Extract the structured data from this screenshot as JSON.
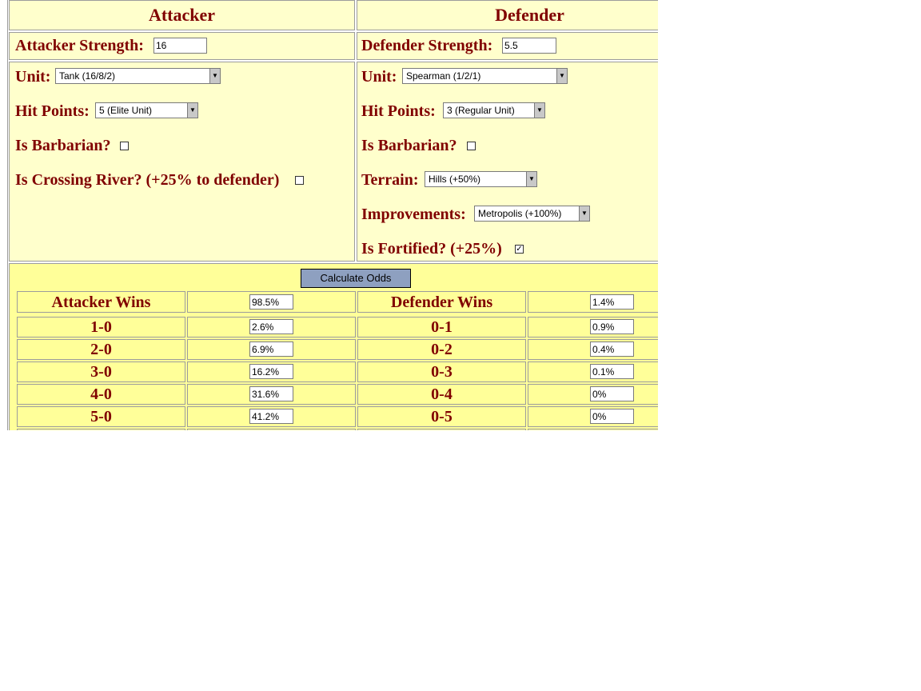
{
  "headers": {
    "attacker": "Attacker",
    "defender": "Defender"
  },
  "attacker": {
    "strength_label": "Attacker Strength:",
    "strength_value": "16",
    "unit_label": "Unit:",
    "unit_value": "Tank (16/8/2)",
    "hp_label": "Hit Points:",
    "hp_value": "5 (Elite Unit)",
    "barbarian_label": "Is Barbarian?",
    "barbarian_checked": false,
    "river_label": "Is Crossing River? (+25% to defender)",
    "river_checked": false
  },
  "defender": {
    "strength_label": "Defender Strength:",
    "strength_value": "5.5",
    "unit_label": "Unit:",
    "unit_value": "Spearman (1/2/1)",
    "hp_label": "Hit Points:",
    "hp_value": "3 (Regular Unit)",
    "barbarian_label": "Is Barbarian?",
    "barbarian_checked": false,
    "terrain_label": "Terrain:",
    "terrain_value": "Hills (+50%)",
    "improvements_label": "Improvements:",
    "improvements_value": "Metropolis (+100%)",
    "fortified_label": "Is Fortified? (+25%)",
    "fortified_checked": true
  },
  "calculate_button": "Calculate Odds",
  "results": {
    "attacker_wins_label": "Attacker Wins",
    "attacker_wins_value": "98.5%",
    "defender_wins_label": "Defender Wins",
    "defender_wins_value": "1.4%",
    "rows": [
      {
        "a_score": "1-0",
        "a_value": "2.6%",
        "d_score": "0-1",
        "d_value": "0.9%"
      },
      {
        "a_score": "2-0",
        "a_value": "6.9%",
        "d_score": "0-2",
        "d_value": "0.4%"
      },
      {
        "a_score": "3-0",
        "a_value": "16.2%",
        "d_score": "0-3",
        "d_value": "0.1%"
      },
      {
        "a_score": "4-0",
        "a_value": "31.6%",
        "d_score": "0-4",
        "d_value": "0%"
      },
      {
        "a_score": "5-0",
        "a_value": "41.2%",
        "d_score": "0-5",
        "d_value": "0%"
      }
    ]
  },
  "icons": {
    "dropdown": "chevron-down-icon",
    "checkmark": "check-icon"
  },
  "colors": {
    "label_text": "#800000",
    "panel_bg": "#ffffcc",
    "results_bg": "#ffff99",
    "button_bg": "#8ea0c0"
  }
}
